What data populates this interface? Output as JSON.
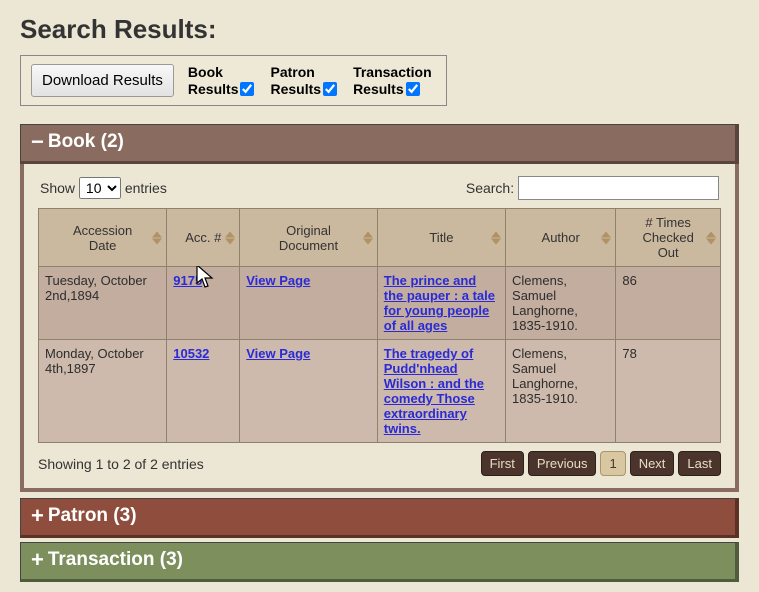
{
  "page_title": "Search Results:",
  "download_label": "Download Results",
  "checkboxes": {
    "book": {
      "line1": "Book",
      "line2": "Results",
      "checked": true
    },
    "patron": {
      "line1": "Patron",
      "line2": "Results",
      "checked": true
    },
    "transaction": {
      "line1": "Transaction",
      "line2": "Results",
      "checked": true
    }
  },
  "sections": {
    "book": {
      "label": "Book (2)",
      "expanded": true
    },
    "patron": {
      "label": "Patron (3)",
      "expanded": false
    },
    "transaction": {
      "label": "Transaction (3)",
      "expanded": false
    }
  },
  "table_controls": {
    "show_prefix": "Show",
    "show_suffix": "entries",
    "length_value": "10",
    "search_label": "Search:",
    "search_value": ""
  },
  "columns": {
    "accession_date": "Accession\nDate",
    "acc_num": "Acc. #",
    "original_doc": "Original\nDocument",
    "title": "Title",
    "author": "Author",
    "times_out": "# Times\nChecked\nOut"
  },
  "rows": [
    {
      "accession_date": "Tuesday, October 2nd,1894",
      "acc_num": "9175",
      "original_doc": "View Page",
      "title": "The prince and the pauper : a tale for young people of all ages",
      "author": "Clemens, Samuel Langhorne, 1835-1910.",
      "times_out": "86"
    },
    {
      "accession_date": "Monday, October 4th,1897",
      "acc_num": "10532",
      "original_doc": "View Page",
      "title": "The tragedy of Pudd'nhead Wilson : and the comedy Those extraordinary twins.",
      "author": "Clemens, Samuel Langhorne, 1835-1910.",
      "times_out": "78"
    }
  ],
  "info_text": "Showing 1 to 2 of 2 entries",
  "pager": {
    "first": "First",
    "previous": "Previous",
    "page": "1",
    "next": "Next",
    "last": "Last"
  }
}
